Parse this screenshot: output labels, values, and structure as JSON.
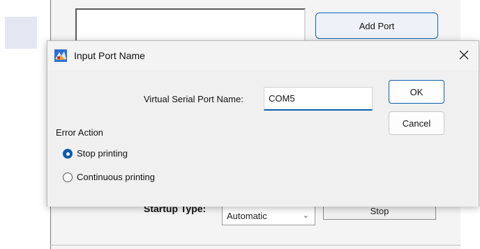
{
  "background": {
    "add_port_label": "Add Port",
    "startup_type_label": "Startup Type:",
    "startup_type_value": "Automatic",
    "stop_label": "Stop"
  },
  "dialog": {
    "title": "Input Port Name",
    "virtual_port_label": "Virtual Serial Port Name:",
    "virtual_port_value": "COM5",
    "ok_label": "OK",
    "cancel_label": "Cancel",
    "error_action_label": "Error Action",
    "error_action_options": [
      {
        "label": "Stop printing",
        "selected": true
      },
      {
        "label": "Continuous printing",
        "selected": false
      }
    ]
  },
  "colors": {
    "accent": "#0b5cad",
    "dialog_bg": "#f0f0f0"
  },
  "icons": {
    "app_icon": "printer-app-icon",
    "close": "close-icon",
    "dropdown": "chevron-down-icon"
  }
}
